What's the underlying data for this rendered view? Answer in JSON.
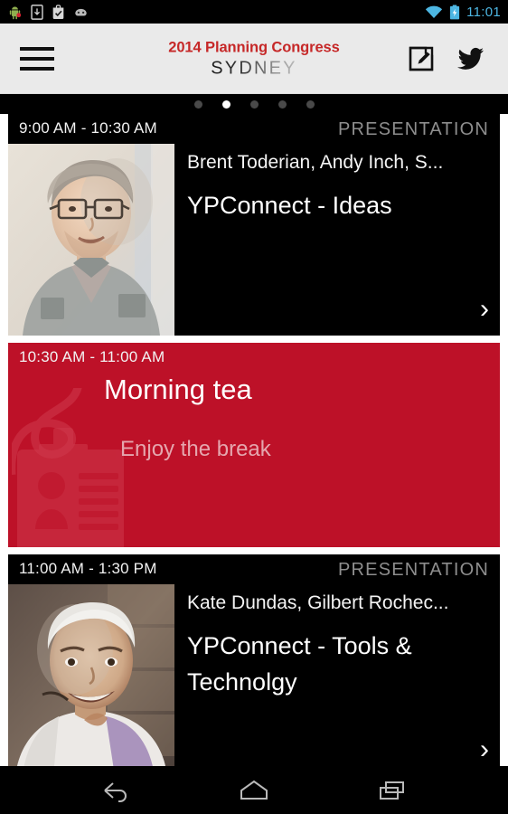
{
  "statusbar": {
    "icons_left": [
      "android-robot-icon",
      "download-icon",
      "checkbox-app-icon",
      "cyanogenmod-icon"
    ],
    "wifi_icon": "wifi-icon",
    "battery_icon": "battery-charging-icon",
    "clock": "11:01",
    "accent_color": "#4db6e2"
  },
  "header": {
    "menu_icon": "hamburger-menu-icon",
    "title": "2014 Planning Congress",
    "subtitle": "SYDNEY",
    "title_color": "#c62828",
    "compose_icon": "compose-edit-icon",
    "twitter_icon": "twitter-bird-icon"
  },
  "pager": {
    "count": 5,
    "active_index": 1
  },
  "schedule": {
    "items": [
      {
        "time": "9:00 AM - 10:30 AM",
        "kind": "PRESENTATION",
        "speakers": "Brent Toderian, Andy Inch, S...",
        "title": "YPConnect - Ideas",
        "chevron": "›",
        "theme": "dark",
        "has_thumb": true
      },
      {
        "time": "10:30 AM - 11:00 AM",
        "kind": "",
        "title": "Morning tea",
        "subtitle": "Enjoy the break",
        "theme": "red",
        "has_thumb": false,
        "watermark_icon": "id-badge-lanyard-icon"
      },
      {
        "time": "11:00 AM - 1:30 PM",
        "kind": "PRESENTATION",
        "speakers": "Kate Dundas, Gilbert Rochec...",
        "title": "YPConnect - Tools & Technolgy",
        "chevron": "›",
        "theme": "dark",
        "has_thumb": true
      }
    ],
    "brand_red": "#bd1128"
  },
  "navbar": {
    "back_icon": "back-arrow-icon",
    "home_icon": "home-icon",
    "recents_icon": "recent-apps-icon"
  }
}
